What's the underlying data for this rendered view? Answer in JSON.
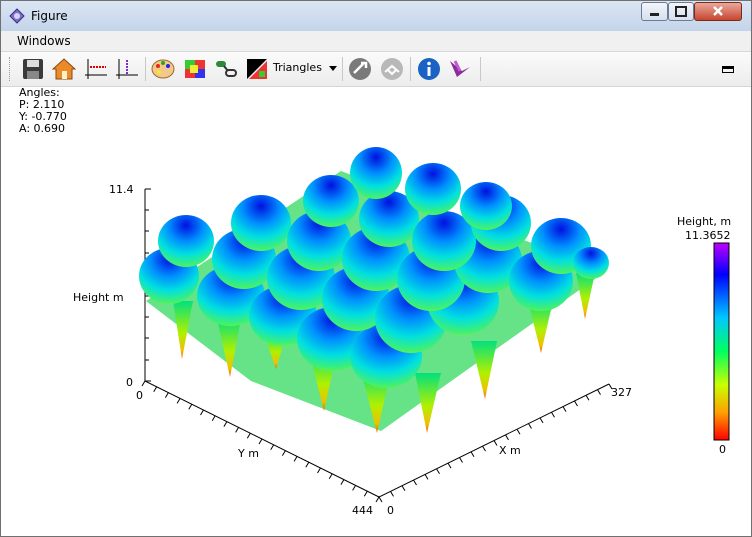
{
  "window": {
    "title": "Figure"
  },
  "menu": {
    "windows_label": "Windows"
  },
  "toolbar": {
    "buttons": [
      "save-icon",
      "home-icon",
      "pan-x-icon",
      "pan-y-icon",
      "palette-icon",
      "colormap-icon",
      "link-icon",
      "color-toggle-icon",
      "tools-icon",
      "grid-icon",
      "info-icon",
      "logo-icon"
    ],
    "mode_label": "Triangles"
  },
  "angles": {
    "heading": "Angles:",
    "p": "P: 2.110",
    "y": "Y: -0.770",
    "a": "A: 0.690"
  },
  "plot": {
    "z_max_tick": "11.4",
    "z_min_tick": "0",
    "z_label": "Height m",
    "y_label": "Y m",
    "x_label": "X m",
    "y_start_tick": "0",
    "y_end_tick": "444",
    "x_start_tick": "0",
    "x_end_tick": "327"
  },
  "colorbar": {
    "title": "Height, m",
    "max_value": "11.3652",
    "min_value": "0"
  }
}
